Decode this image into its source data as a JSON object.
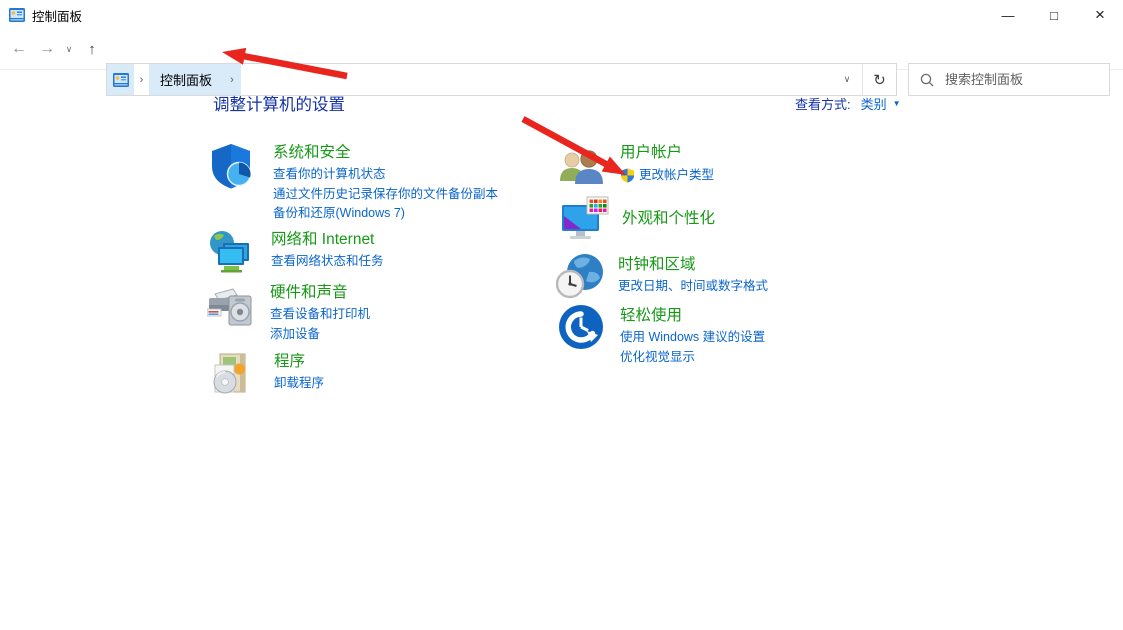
{
  "window": {
    "title": "控制面板",
    "minimize": "—",
    "maximize": "□",
    "close": "×"
  },
  "navbar": {
    "back": "←",
    "forward": "→",
    "nav_dropdown": "∨",
    "up": "↑",
    "breadcrumb_separator": "›",
    "breadcrumb_root": "控制面板",
    "address_dropdown": "∨",
    "refresh": "↻",
    "search_placeholder": "搜索控制面板"
  },
  "content": {
    "heading": "调整计算机的设置",
    "view_by_label": "查看方式:",
    "view_by_value": "类别",
    "view_by_arrow": "▼",
    "left": [
      {
        "title": "系统和安全",
        "links": [
          "查看你的计算机状态",
          "通过文件历史记录保存你的文件备份副本",
          "备份和还原(Windows 7)"
        ]
      },
      {
        "title": "网络和 Internet",
        "links": [
          "查看网络状态和任务"
        ]
      },
      {
        "title": "硬件和声音",
        "links": [
          "查看设备和打印机",
          "添加设备"
        ]
      },
      {
        "title": "程序",
        "links": [
          "卸载程序"
        ]
      }
    ],
    "right": [
      {
        "title": "用户帐户",
        "links": [
          "更改帐户类型"
        ]
      },
      {
        "title": "外观和个性化",
        "links": []
      },
      {
        "title": "时钟和区域",
        "links": [
          "更改日期、时间或数字格式"
        ]
      },
      {
        "title": "轻松使用",
        "links": [
          "使用 Windows 建议的设置",
          "优化视觉显示"
        ]
      }
    ]
  },
  "colors": {
    "category_title_green": "#179917",
    "task_link_blue": "#0a66cc",
    "heading_navy": "#1432a8",
    "breadcrumb_highlight": "#d9eaf9",
    "annotation_arrow_red": "#e8261d"
  }
}
